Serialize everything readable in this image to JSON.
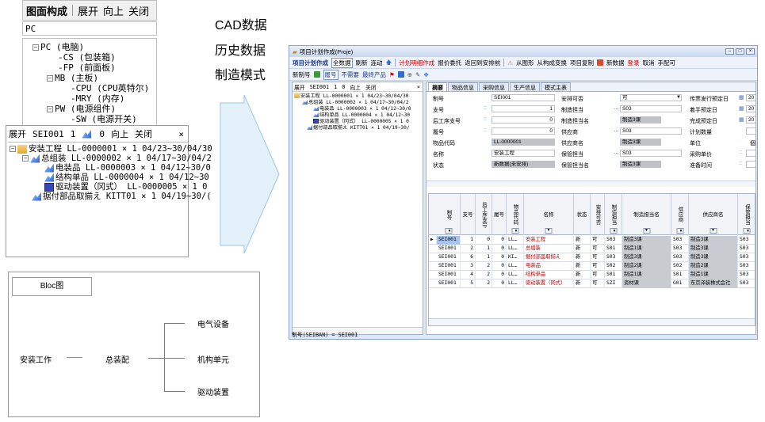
{
  "drawing_panel": {
    "toolbar": [
      "图面构成",
      "展开",
      "向上",
      "关闭"
    ],
    "filter_value": "PC",
    "tree": [
      {
        "text": "PC (电脑)",
        "box": "−"
      },
      {
        "text": "CS (包装箱)"
      },
      {
        "text": "FP (前面板)"
      },
      {
        "text": "MB (主板)",
        "box": "−"
      },
      {
        "text": "CPU (CPU英特尔)"
      },
      {
        "text": "MRY (内存)"
      },
      {
        "text": "PW (电源组件)",
        "box": "−"
      },
      {
        "text": "SW (电源开关)"
      }
    ]
  },
  "small_window": {
    "expand": "展开",
    "code": "SEI001",
    "qty": "1",
    "num": "0",
    "up": "向上",
    "close": "关闭",
    "close_x": "×",
    "tree": [
      {
        "text": "安装工程 LL-0000001  × 1 04/23~30/04/30"
      },
      {
        "text": "总组装 LL-0000002  × 1 04/17~30/04/2"
      },
      {
        "text": "电装品 LL-0000003  × 1 04/12~30/0"
      },
      {
        "text": "结构单品 LL-0000004  × 1 04/12~30"
      },
      {
        "text": "驱动装置（冈式） LL-0000005  × 1 0"
      },
      {
        "text": "据付部品取揃え KITT01  × 1 04/19~30/("
      }
    ]
  },
  "bloc": {
    "title": "Bloc图",
    "install": "安装工作",
    "dash": "——",
    "assembly": "总装配",
    "electrical": "电气设备",
    "mechanism": "机构单元",
    "drive": "驱动装置"
  },
  "labels": [
    "CAD数据",
    "历史数据",
    "制造模式"
  ],
  "app": {
    "title": "项目计划作成(Proje)",
    "toolbar1": {
      "main": "项目计划作成",
      "items_a": [
        "全数据",
        "刷新",
        "连动"
      ],
      "items_b": [
        "计划明细作成",
        "报价委托",
        "返回到安排前"
      ],
      "items_c": [
        "从图形",
        "从构成变换",
        "项目复制"
      ],
      "items_d": [
        "新数据",
        "登录",
        "取消",
        "手配可"
      ]
    },
    "toolbar2": {
      "new_no": "新制号",
      "labels": [
        "履号",
        "不需要",
        "最终产品"
      ]
    },
    "left": {
      "expand": "展开",
      "code": "SEI001",
      "qty": "1",
      "num": "0",
      "up": "向上",
      "close": "关闭",
      "close_x": "×",
      "tree": [
        "安装工程 LL-0000001 × 1 04/23~30/04/30",
        "总组装 LL-0000002 × 1 04/17~30/04/2",
        "电装品 LL-0000003 × 1 04/12~30/0",
        "结构单品 LL-0000004 × 1 04/12~30",
        "驱动装置（冈式） LL-0000005 × 1 0",
        "据付部品取揃え KITT01 × 1 04/19~30/"
      ]
    },
    "tabs": [
      "摘要",
      "物品信息",
      "采购信息",
      "生产信息",
      "模式主表"
    ],
    "form": {
      "labels_left": [
        "制号",
        "支号",
        "后工序支号",
        "履号",
        "物品代码",
        "名称",
        "状态"
      ],
      "values_left": [
        "SEI001",
        "1",
        "0",
        "0",
        "LL-0000001",
        "安装工程",
        "新数据(未安排)"
      ],
      "labels_mid": [
        "安排可否",
        "制造担当",
        "制造担当名",
        "供应商",
        "供应商名",
        "保管担当",
        "保管担当名"
      ],
      "values_mid": [
        "可",
        "S03",
        "制造3课",
        "S03",
        "制造3课",
        "S03",
        "制造3课"
      ],
      "labels_right": [
        "传票发行预定日",
        "着手预定日",
        "完成预定日",
        "计划数量",
        "单位",
        "采购单价",
        "准备时间"
      ],
      "values_right": [
        "20",
        "20",
        "20",
        "",
        "個",
        "",
        ""
      ]
    },
    "grid": {
      "headers": [
        "制号",
        "支号",
        "后工序支号",
        "履号",
        "物品代码",
        "名称",
        "状态",
        "安排可否",
        "制造担当",
        "制造担当名",
        "供应商",
        "供应商名",
        "保管担当"
      ],
      "rows": [
        [
          "SEI001",
          "1",
          "0",
          "0",
          "LL…",
          "安装工程",
          "新",
          "可",
          "S03",
          "制造3课",
          "S03",
          "制造3课",
          "S03"
        ],
        [
          "SEI001",
          "2",
          "1",
          "0",
          "LL…",
          "总组装",
          "新",
          "可",
          "S01",
          "制造1课",
          "S03",
          "制造3课",
          "S03"
        ],
        [
          "SEI001",
          "6",
          "1",
          "0",
          "KI…",
          "据付部品取揃え",
          "新",
          "可",
          "S03",
          "制造3课",
          "S03",
          "制造3课",
          "S03"
        ],
        [
          "SEI001",
          "3",
          "2",
          "0",
          "LL…",
          "电装品",
          "新",
          "可",
          "S02",
          "制造2课",
          "S02",
          "制造2课",
          "S03"
        ],
        [
          "SEI001",
          "4",
          "2",
          "0",
          "LL…",
          "结构单品",
          "新",
          "可",
          "S01",
          "制造1课",
          "S01",
          "制造1课",
          "S03"
        ],
        [
          "SEI001",
          "5",
          "2",
          "0",
          "LL…",
          "驱动装置（冈式）",
          "新",
          "可",
          "SZI",
          "资材课",
          "G01",
          "东京泽装株式会社",
          "S03"
        ]
      ]
    },
    "status": "制号(SEIBAN) = SEI001"
  }
}
